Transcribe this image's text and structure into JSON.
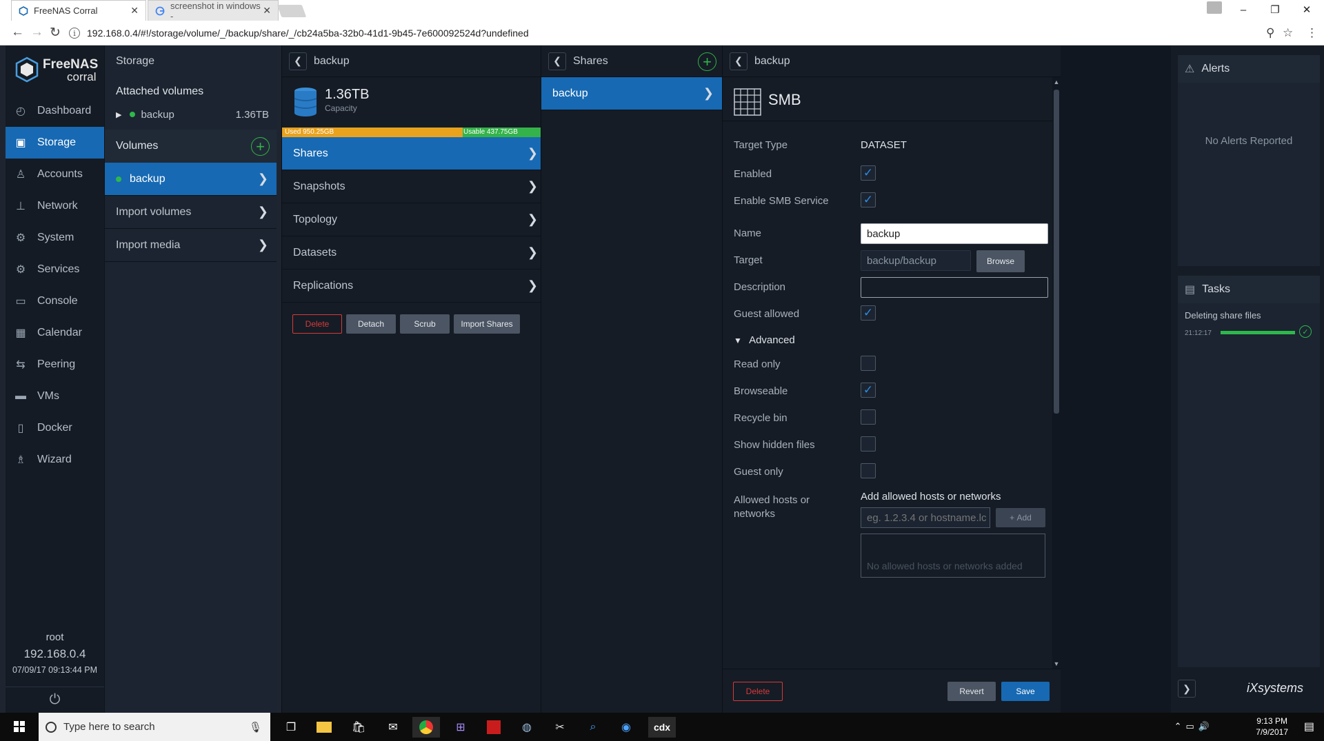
{
  "browser": {
    "tabs": [
      {
        "title": "FreeNAS Corral",
        "active": true
      },
      {
        "title": "screenshot in windows -",
        "active": false
      }
    ],
    "url": "192.168.0.4/#!/storage/volume/_/backup/share/_/cb24a5ba-32b0-41d1-9b45-7e600092524d?undefined"
  },
  "sidebar": {
    "logo_line1": "FreeNAS",
    "logo_line2": "corral",
    "items": [
      {
        "label": "Dashboard",
        "icon": "dashboard-icon"
      },
      {
        "label": "Storage",
        "icon": "storage-icon",
        "active": true
      },
      {
        "label": "Accounts",
        "icon": "accounts-icon"
      },
      {
        "label": "Network",
        "icon": "network-icon"
      },
      {
        "label": "System",
        "icon": "system-icon"
      },
      {
        "label": "Services",
        "icon": "services-icon"
      },
      {
        "label": "Console",
        "icon": "console-icon"
      },
      {
        "label": "Calendar",
        "icon": "calendar-icon"
      },
      {
        "label": "Peering",
        "icon": "peering-icon"
      },
      {
        "label": "VMs",
        "icon": "vms-icon"
      },
      {
        "label": "Docker",
        "icon": "docker-icon"
      },
      {
        "label": "Wizard",
        "icon": "wizard-icon"
      }
    ],
    "session": {
      "user": "root",
      "ip": "192.168.0.4",
      "datetime": "07/09/17 09:13:44 PM"
    }
  },
  "storage": {
    "title": "Storage",
    "attached_label": "Attached volumes",
    "attached": [
      {
        "name": "backup",
        "size": "1.36TB"
      }
    ],
    "volumes_label": "Volumes",
    "volumes": [
      {
        "name": "backup"
      }
    ],
    "links": [
      "Import volumes",
      "Import media"
    ]
  },
  "volume": {
    "title": "backup",
    "capacity_value": "1.36TB",
    "capacity_label": "Capacity",
    "used_label": "Used 950.25GB",
    "usable_label": "Usable 437.75GB",
    "used_fraction": 0.685,
    "menu": [
      "Shares",
      "Snapshots",
      "Topology",
      "Datasets",
      "Replications"
    ],
    "buttons": {
      "delete": "Delete",
      "detach": "Detach",
      "scrub": "Scrub",
      "import_shares": "Import Shares"
    }
  },
  "shares": {
    "title": "Shares",
    "items": [
      "backup"
    ]
  },
  "share": {
    "back_title": "backup",
    "type_title": "SMB",
    "fields": {
      "target_type_label": "Target Type",
      "target_type_value": "DATASET",
      "enabled_label": "Enabled",
      "enabled": true,
      "enable_smb_label": "Enable SMB Service",
      "enable_smb": true,
      "name_label": "Name",
      "name_value": "backup",
      "target_label": "Target",
      "target_value": "backup/backup",
      "browse_label": "Browse",
      "description_label": "Description",
      "description_value": "",
      "guest_allowed_label": "Guest allowed",
      "guest_allowed": true,
      "advanced_label": "Advanced",
      "read_only_label": "Read only",
      "read_only": false,
      "browseable_label": "Browseable",
      "browseable": true,
      "recycle_bin_label": "Recycle bin",
      "recycle_bin": false,
      "show_hidden_label": "Show hidden files",
      "show_hidden": false,
      "guest_only_label": "Guest only",
      "guest_only": false,
      "allowed_hosts_label": "Allowed hosts or networks",
      "add_hosts_title": "Add allowed hosts or networks",
      "hosts_placeholder": "eg. 1.2.3.4 or hostname.lc",
      "add_label": "Add",
      "no_hosts": "No allowed hosts or networks added"
    },
    "buttons": {
      "delete": "Delete",
      "revert": "Revert",
      "save": "Save"
    }
  },
  "alerts": {
    "title": "Alerts",
    "empty": "No Alerts Reported"
  },
  "tasks": {
    "title": "Tasks",
    "items": [
      {
        "name": "Deleting share files",
        "time": "21:12:17",
        "progress": 1.0
      }
    ]
  },
  "brand": "iXsystems",
  "taskbar": {
    "search_placeholder": "Type here to search",
    "time": "9:13 PM",
    "date": "7/9/2017"
  },
  "colors": {
    "accent": "#1769b3",
    "success": "#2eb84b",
    "danger": "#d83a3a",
    "used": "#e9a21d"
  }
}
